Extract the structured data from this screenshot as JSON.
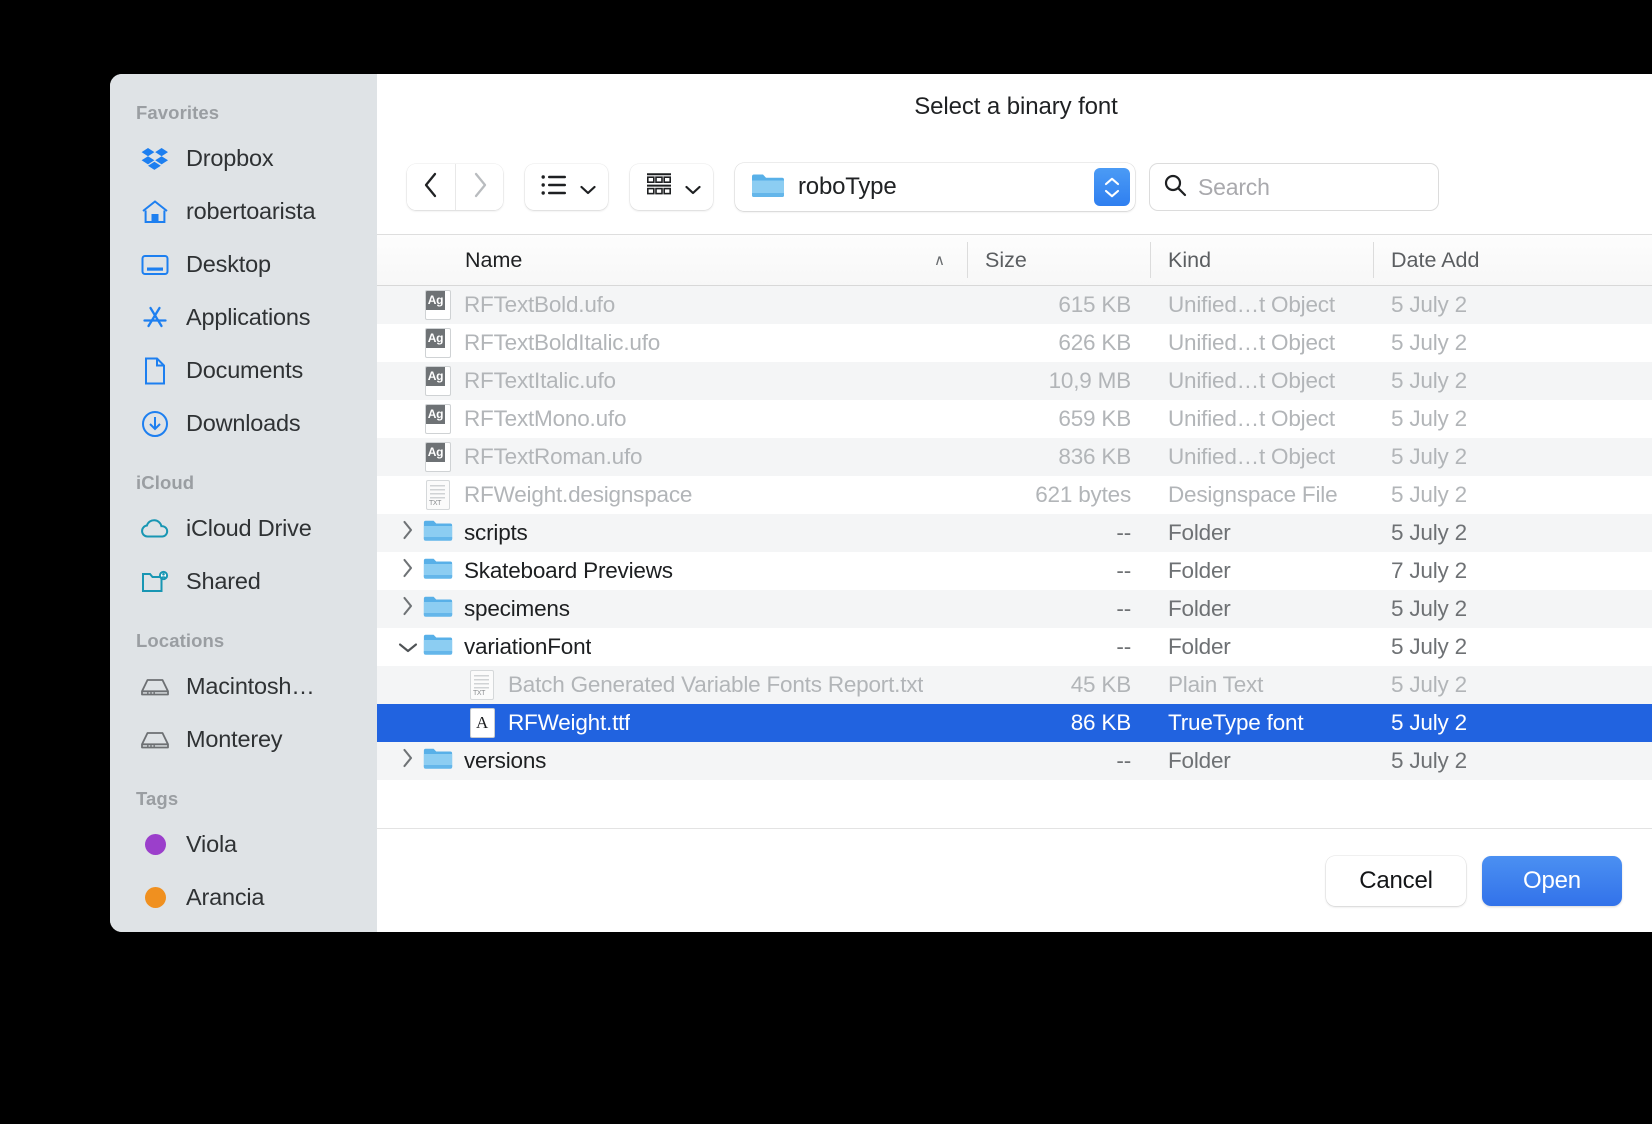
{
  "dialog": {
    "title": "Select a binary font"
  },
  "sidebar": {
    "groups": [
      {
        "title": "Favorites",
        "items": [
          {
            "label": "Dropbox",
            "icon": "dropbox-icon"
          },
          {
            "label": "robertoarista",
            "icon": "home-icon"
          },
          {
            "label": "Desktop",
            "icon": "desktop-icon"
          },
          {
            "label": "Applications",
            "icon": "applications-icon"
          },
          {
            "label": "Documents",
            "icon": "document-icon"
          },
          {
            "label": "Downloads",
            "icon": "downloads-icon"
          }
        ]
      },
      {
        "title": "iCloud",
        "items": [
          {
            "label": "iCloud Drive",
            "icon": "cloud-icon"
          },
          {
            "label": "Shared",
            "icon": "shared-folder-icon"
          }
        ]
      },
      {
        "title": "Locations",
        "items": [
          {
            "label": "Macintosh…",
            "icon": "hard-drive-icon"
          },
          {
            "label": "Monterey",
            "icon": "hard-drive-icon"
          }
        ]
      },
      {
        "title": "Tags",
        "items": [
          {
            "label": "Viola",
            "icon": "tag-dot-icon",
            "color": "#9b3fcb"
          },
          {
            "label": "Arancia",
            "icon": "tag-dot-icon",
            "color": "#f0901f"
          }
        ]
      }
    ]
  },
  "toolbar": {
    "back_icon": "chevron-left-icon",
    "forward_icon": "chevron-right-icon",
    "list_view_icon": "list-view-icon",
    "icon_view_icon": "grid-view-icon",
    "path_folder_icon": "folder-icon",
    "path_label": "roboType",
    "stepper_icon": "stepper-up-down-icon",
    "search_icon": "search-icon",
    "search_placeholder": "Search",
    "search_value": ""
  },
  "table": {
    "columns": [
      {
        "key": "name",
        "label": "Name",
        "sort_caret": "∧"
      },
      {
        "key": "size",
        "label": "Size"
      },
      {
        "key": "kind",
        "label": "Kind"
      },
      {
        "key": "date",
        "label": "Date Add"
      }
    ],
    "rows": [
      {
        "name": "RFTextBold.ufo",
        "size": "615 KB",
        "kind": "Unified…t Object",
        "date": "5 July 2",
        "icon": "ufo-file-icon",
        "state": "disabled",
        "indent": 0,
        "disclosure": ""
      },
      {
        "name": "RFTextBoldItalic.ufo",
        "size": "626 KB",
        "kind": "Unified…t Object",
        "date": "5 July 2",
        "icon": "ufo-file-icon",
        "state": "disabled",
        "indent": 0,
        "disclosure": ""
      },
      {
        "name": "RFTextItalic.ufo",
        "size": "10,9 MB",
        "kind": "Unified…t Object",
        "date": "5 July 2",
        "icon": "ufo-file-icon",
        "state": "disabled",
        "indent": 0,
        "disclosure": ""
      },
      {
        "name": "RFTextMono.ufo",
        "size": "659 KB",
        "kind": "Unified…t Object",
        "date": "5 July 2",
        "icon": "ufo-file-icon",
        "state": "disabled",
        "indent": 0,
        "disclosure": ""
      },
      {
        "name": "RFTextRoman.ufo",
        "size": "836 KB",
        "kind": "Unified…t Object",
        "date": "5 July 2",
        "icon": "ufo-file-icon",
        "state": "disabled",
        "indent": 0,
        "disclosure": ""
      },
      {
        "name": "RFWeight.designspace",
        "size": "621 bytes",
        "kind": "Designspace File",
        "date": "5 July 2",
        "icon": "text-file-icon",
        "state": "disabled",
        "indent": 0,
        "disclosure": ""
      },
      {
        "name": "scripts",
        "size": "--",
        "kind": "Folder",
        "date": "5 July 2",
        "icon": "folder-icon",
        "state": "enabled",
        "indent": 0,
        "disclosure": "collapsed"
      },
      {
        "name": "Skateboard Previews",
        "size": "--",
        "kind": "Folder",
        "date": "7 July 2",
        "icon": "folder-icon",
        "state": "enabled",
        "indent": 0,
        "disclosure": "collapsed"
      },
      {
        "name": "specimens",
        "size": "--",
        "kind": "Folder",
        "date": "5 July 2",
        "icon": "folder-icon",
        "state": "enabled",
        "indent": 0,
        "disclosure": "collapsed"
      },
      {
        "name": "variationFont",
        "size": "--",
        "kind": "Folder",
        "date": "5 July 2",
        "icon": "folder-icon",
        "state": "enabled",
        "indent": 0,
        "disclosure": "expanded"
      },
      {
        "name": "Batch Generated Variable Fonts Report.txt",
        "size": "45 KB",
        "kind": "Plain Text",
        "date": "5 July 2",
        "icon": "text-file-icon",
        "state": "disabled",
        "indent": 1,
        "disclosure": ""
      },
      {
        "name": "RFWeight.ttf",
        "size": "86 KB",
        "kind": "TrueType font",
        "date": "5 July 2",
        "icon": "ttf-file-icon",
        "state": "selected",
        "indent": 1,
        "disclosure": ""
      },
      {
        "name": "versions",
        "size": "--",
        "kind": "Folder",
        "date": "5 July 2",
        "icon": "folder-icon",
        "state": "enabled",
        "indent": 0,
        "disclosure": "collapsed"
      }
    ]
  },
  "footer": {
    "cancel_label": "Cancel",
    "open_label": "Open"
  },
  "colors": {
    "selection_blue": "#2163e0",
    "accent_blue": "#3272ea",
    "sidebar_bg": "#dfe3e6",
    "folder_blue": "#6cb8ea"
  }
}
